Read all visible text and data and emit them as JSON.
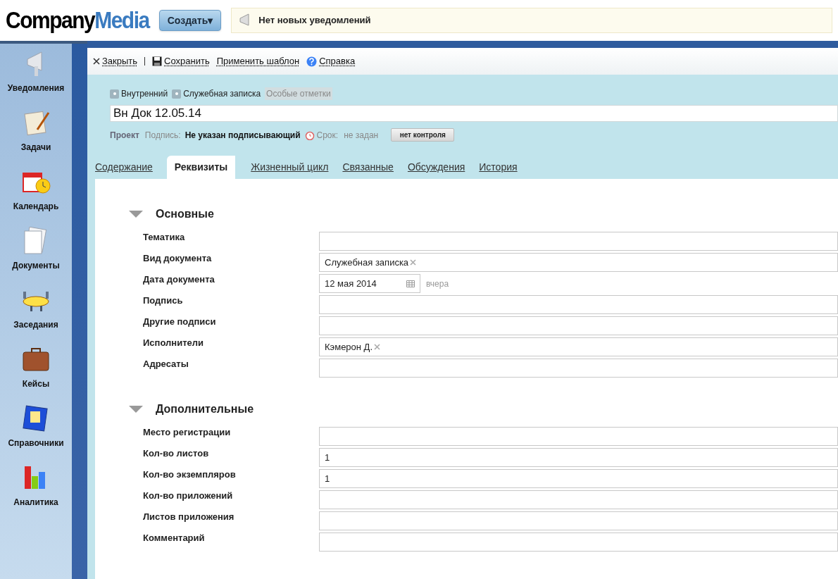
{
  "header": {
    "logo": {
      "dark": "Company",
      "accent": "Media"
    },
    "create_button": "Создать▾",
    "notification": "Нет новых уведомлений"
  },
  "sidebar": {
    "items": [
      {
        "label": "Уведомления",
        "kind": "megaphone"
      },
      {
        "label": "Задачи",
        "kind": "clipboard"
      },
      {
        "label": "Календарь",
        "kind": "calendar"
      },
      {
        "label": "Документы",
        "kind": "documents"
      },
      {
        "label": "Заседания",
        "kind": "meeting"
      },
      {
        "label": "Кейсы",
        "kind": "briefcase"
      },
      {
        "label": "Справочники",
        "kind": "book"
      },
      {
        "label": "Аналитика",
        "kind": "chart"
      }
    ]
  },
  "toolbar": [
    {
      "label": "Закрыть",
      "kind": "close"
    },
    {
      "label": "Сохранить",
      "kind": "save"
    },
    {
      "label": "Применить шаблон",
      "kind": "plain"
    },
    {
      "label": "Справка",
      "kind": "help"
    }
  ],
  "flags": [
    {
      "label": "Внутренний",
      "kind": "marked"
    },
    {
      "label": "Служебная записка",
      "kind": "marked"
    },
    {
      "label": "Особые отметки",
      "kind": "muted"
    }
  ],
  "title_field": {
    "value": "Вн Док 12.05.14"
  },
  "meta": {
    "project": "Проект",
    "sign_label": "Подпись:",
    "sign_value": "Не указан подписывающий",
    "due_label": "Срок:",
    "due_value": "не задан",
    "control_button": "нет контроля"
  },
  "tabs": [
    {
      "label": "Содержание",
      "selected": false
    },
    {
      "label": "Реквизиты",
      "selected": true
    },
    {
      "label": "Жизненный цикл",
      "selected": false
    },
    {
      "label": "Связанные",
      "selected": false
    },
    {
      "label": "Обсуждения",
      "selected": false
    },
    {
      "label": "История",
      "selected": false
    }
  ],
  "sections": [
    {
      "title": "Основные",
      "expanded": true,
      "fields": [
        {
          "label": "Тематика",
          "kind": "text"
        },
        {
          "label": "Вид документа",
          "kind": "tags",
          "tags": [
            "Служебная записка"
          ]
        },
        {
          "label": "Дата документа",
          "kind": "date",
          "value": "12 мая 2014",
          "hint": "вчера"
        },
        {
          "label": "Подпись",
          "kind": "text"
        },
        {
          "label": "Другие подписи",
          "kind": "text"
        },
        {
          "label": "Исполнители",
          "kind": "tags",
          "tags": [
            "Кэмерон Д."
          ]
        },
        {
          "label": "Адресаты",
          "kind": "text"
        }
      ]
    },
    {
      "title": "Дополнительные",
      "expanded": true,
      "fields": [
        {
          "label": "Место регистрации",
          "kind": "text"
        },
        {
          "label": "Кол-во листов",
          "kind": "text",
          "value": "1"
        },
        {
          "label": "Кол-во экземпляров",
          "kind": "text",
          "value": "1"
        },
        {
          "label": "Кол-во приложений",
          "kind": "text"
        },
        {
          "label": "Листов приложения",
          "kind": "text"
        },
        {
          "label": "Комментарий",
          "kind": "text"
        }
      ]
    }
  ]
}
